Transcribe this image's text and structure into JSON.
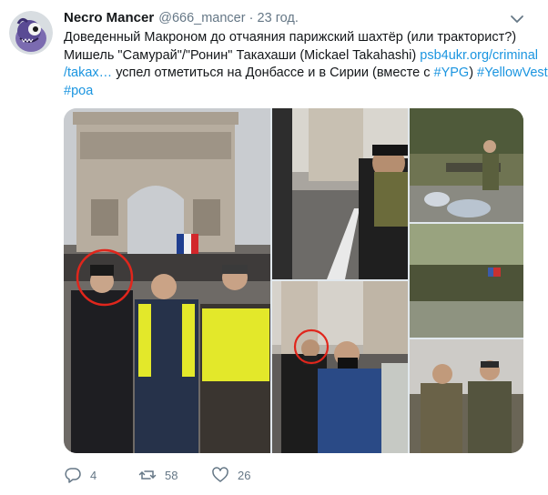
{
  "author": {
    "name": "Necro Mancer",
    "handle": "@666_mancer",
    "separator": "·",
    "time": "23 год."
  },
  "tweet": {
    "line1": "Доведенный Макроном до отчаяния парижский шахтёр (или тракторист?)",
    "line2_text": "Мишель \"Самурай\"/\"Ронин\" Такахаши (Mickael Takahashi) ",
    "line2_link": "psb4ukr.org/criminal",
    "line3_link": "/takax…",
    "line3_text": " успел отметиться на Донбассе и в Сирии (вместе с ",
    "hashtag1": "#YPG",
    "line3_close": ") ",
    "hashtag2": "#YellowVests",
    "hashtag3": "#роа"
  },
  "actions": {
    "reply_count": "4",
    "retweet_count": "58",
    "like_count": "26"
  },
  "icons": {
    "caret": "chevron-down-icon",
    "reply": "reply-icon",
    "retweet": "retweet-icon",
    "like": "heart-icon"
  },
  "colors": {
    "link": "#1b95e0",
    "secondary_text": "#657786",
    "primary_text": "#14171a",
    "highlight_circle": "#e0261c"
  }
}
